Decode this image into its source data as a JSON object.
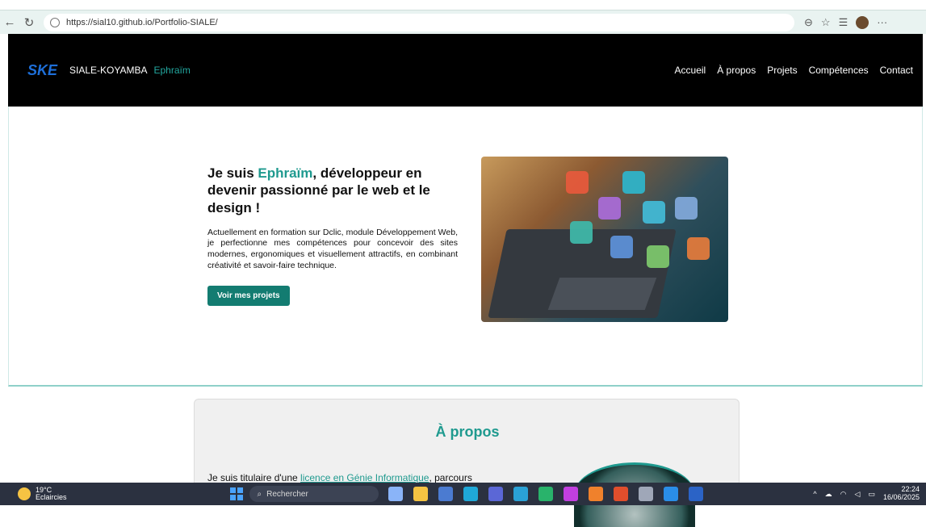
{
  "browser": {
    "url": "https://sial10.github.io/Portfolio-SIALE/",
    "back_icon": "back-arrow-icon",
    "refresh_icon": "refresh-icon",
    "lock_icon": "lock-icon"
  },
  "site": {
    "logo_text": "SKE",
    "brand_name": "SIALE-KOYAMBA",
    "brand_accent": "Ephraïm",
    "nav": [
      "Accueil",
      "À propos",
      "Projets",
      "Compétences",
      "Contact"
    ]
  },
  "hero": {
    "title_before": "Je suis ",
    "title_name": "Ephraïm",
    "title_after": ", développeur en devenir passionné par le web et le design !",
    "description": "Actuellement en formation sur Dclic, module Développement Web, je perfectionne mes compétences pour concevoir des sites modernes, ergonomiques et visuellement attractifs, en combinant créativité et savoir-faire technique.",
    "cta_label": "Voir mes projets"
  },
  "about": {
    "title": "À propos",
    "text_before": "Je suis titulaire d'une ",
    "text_link": "licence en Génie Informatique",
    "text_after": ", parcours"
  },
  "taskbar": {
    "weather_temp": "19°C",
    "weather_desc": "Eclaircies",
    "search_placeholder": "Rechercher",
    "time": "22:24",
    "date": "16/06/2025"
  },
  "colors": {
    "accent": "#1f9a8f",
    "button": "#137c71",
    "header_bg": "#000000",
    "taskbar_bg": "#2b3140"
  }
}
